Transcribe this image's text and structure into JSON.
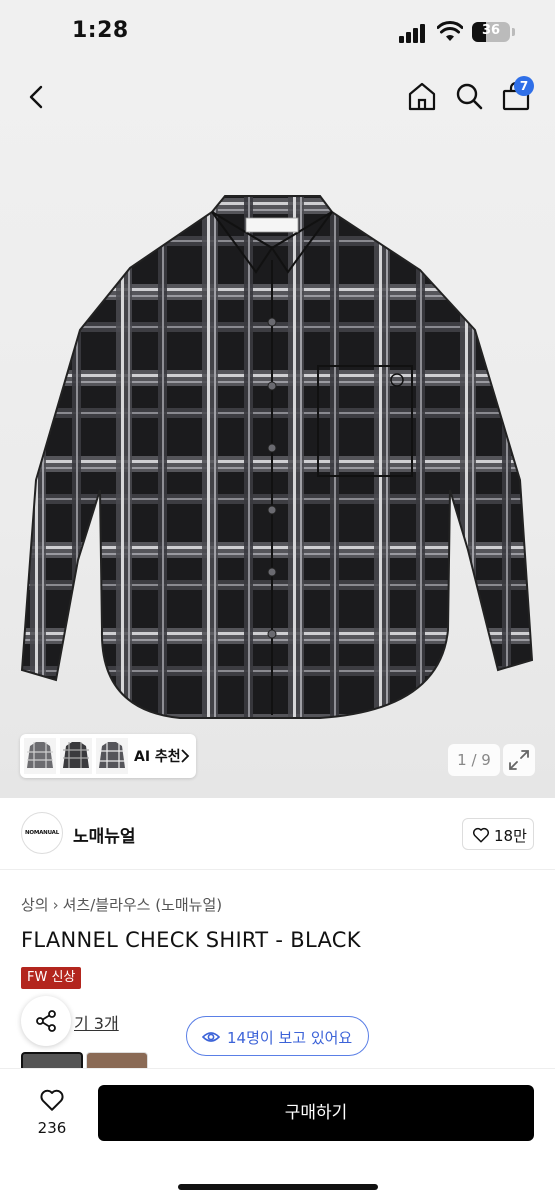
{
  "status": {
    "time": "1:28",
    "battery": "36",
    "battery_level": 0.36
  },
  "nav": {
    "cart_count": "7",
    "icons": [
      "back-icon",
      "home-icon",
      "search-icon",
      "cart-icon"
    ]
  },
  "gallery": {
    "ai_label": "AI 추천",
    "pager": "1 / 9",
    "thumbnails": 3,
    "current_image": 1,
    "total_images": 9
  },
  "seller": {
    "logo_text": "NOMANUAL",
    "name": "노매뉴얼",
    "likes": "18만"
  },
  "product": {
    "breadcrumb": [
      "상의",
      "셔츠/블라우스 (노매뉴얼)"
    ],
    "title": "FLANNEL CHECK SHIRT - BLACK",
    "badge": "FW 신상",
    "review_text": "기 3개",
    "viewing_text": "14명이 보고 있어요"
  },
  "bottom": {
    "wish_count": "236",
    "buy_label": "구매하기"
  },
  "colors": {
    "accent_blue": "#2f6fe8",
    "badge_red": "#b3261e",
    "viewing_blue": "#3c63d8"
  }
}
